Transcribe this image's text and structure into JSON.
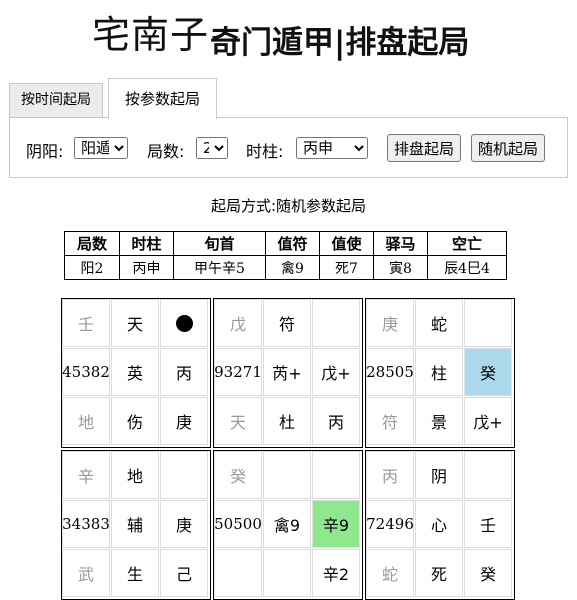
{
  "header": {
    "brand": "宅南子",
    "title": "奇门遁甲|排盘起局"
  },
  "tabs": [
    {
      "label": "按时间起局",
      "active": false
    },
    {
      "label": "按参数起局",
      "active": true
    }
  ],
  "form": {
    "yinyang_label": "阴阳:",
    "yinyang_value": "阳遁",
    "jushu_label": "局数:",
    "jushu_value": "2",
    "shizhu_label": "时柱:",
    "shizhu_value": "丙申",
    "paipan_button": "排盘起局",
    "random_button": "随机起局"
  },
  "method_text": "起局方式:随机参数起局",
  "summary": {
    "headers": [
      "局数",
      "时柱",
      "旬首",
      "值符",
      "值使",
      "驿马",
      "空亡"
    ],
    "values": [
      "阳2",
      "丙申",
      "甲午辛5",
      "禽9",
      "死7",
      "寅8",
      "辰4巳4"
    ]
  },
  "palaces": [
    {
      "cells": [
        {
          "text": "壬",
          "style": "grey"
        },
        {
          "text": "天"
        },
        {
          "text": "",
          "dot": true
        },
        {
          "text": "45382",
          "style": "serif"
        },
        {
          "text": "英"
        },
        {
          "text": "丙"
        },
        {
          "text": "地",
          "style": "grey"
        },
        {
          "text": "伤"
        },
        {
          "text": "庚"
        }
      ]
    },
    {
      "cells": [
        {
          "text": "戊",
          "style": "grey"
        },
        {
          "text": "符"
        },
        {
          "text": ""
        },
        {
          "text": "93271",
          "style": "serif"
        },
        {
          "text": "芮+"
        },
        {
          "text": "戊+"
        },
        {
          "text": "天",
          "style": "grey"
        },
        {
          "text": "杜"
        },
        {
          "text": "丙"
        }
      ]
    },
    {
      "cells": [
        {
          "text": "庚",
          "style": "grey"
        },
        {
          "text": "蛇"
        },
        {
          "text": ""
        },
        {
          "text": "28505",
          "style": "serif"
        },
        {
          "text": "柱"
        },
        {
          "text": "癸",
          "style": "blue"
        },
        {
          "text": "符",
          "style": "grey"
        },
        {
          "text": "景"
        },
        {
          "text": "戊+"
        }
      ]
    },
    {
      "cells": [
        {
          "text": "辛",
          "style": "grey"
        },
        {
          "text": "地"
        },
        {
          "text": ""
        },
        {
          "text": "34383",
          "style": "serif"
        },
        {
          "text": "辅"
        },
        {
          "text": "庚"
        },
        {
          "text": "武",
          "style": "grey"
        },
        {
          "text": "生"
        },
        {
          "text": "己"
        }
      ]
    },
    {
      "cells": [
        {
          "text": "癸",
          "style": "grey"
        },
        {
          "text": ""
        },
        {
          "text": ""
        },
        {
          "text": "50500",
          "style": "serif"
        },
        {
          "text": "禽9"
        },
        {
          "text": "辛9",
          "style": "green"
        },
        {
          "text": ""
        },
        {
          "text": ""
        },
        {
          "text": "辛2"
        }
      ]
    },
    {
      "cells": [
        {
          "text": "丙",
          "style": "grey"
        },
        {
          "text": "阴"
        },
        {
          "text": ""
        },
        {
          "text": "72496",
          "style": "serif"
        },
        {
          "text": "心"
        },
        {
          "text": "壬"
        },
        {
          "text": "蛇",
          "style": "grey"
        },
        {
          "text": "死"
        },
        {
          "text": "癸"
        }
      ]
    }
  ]
}
